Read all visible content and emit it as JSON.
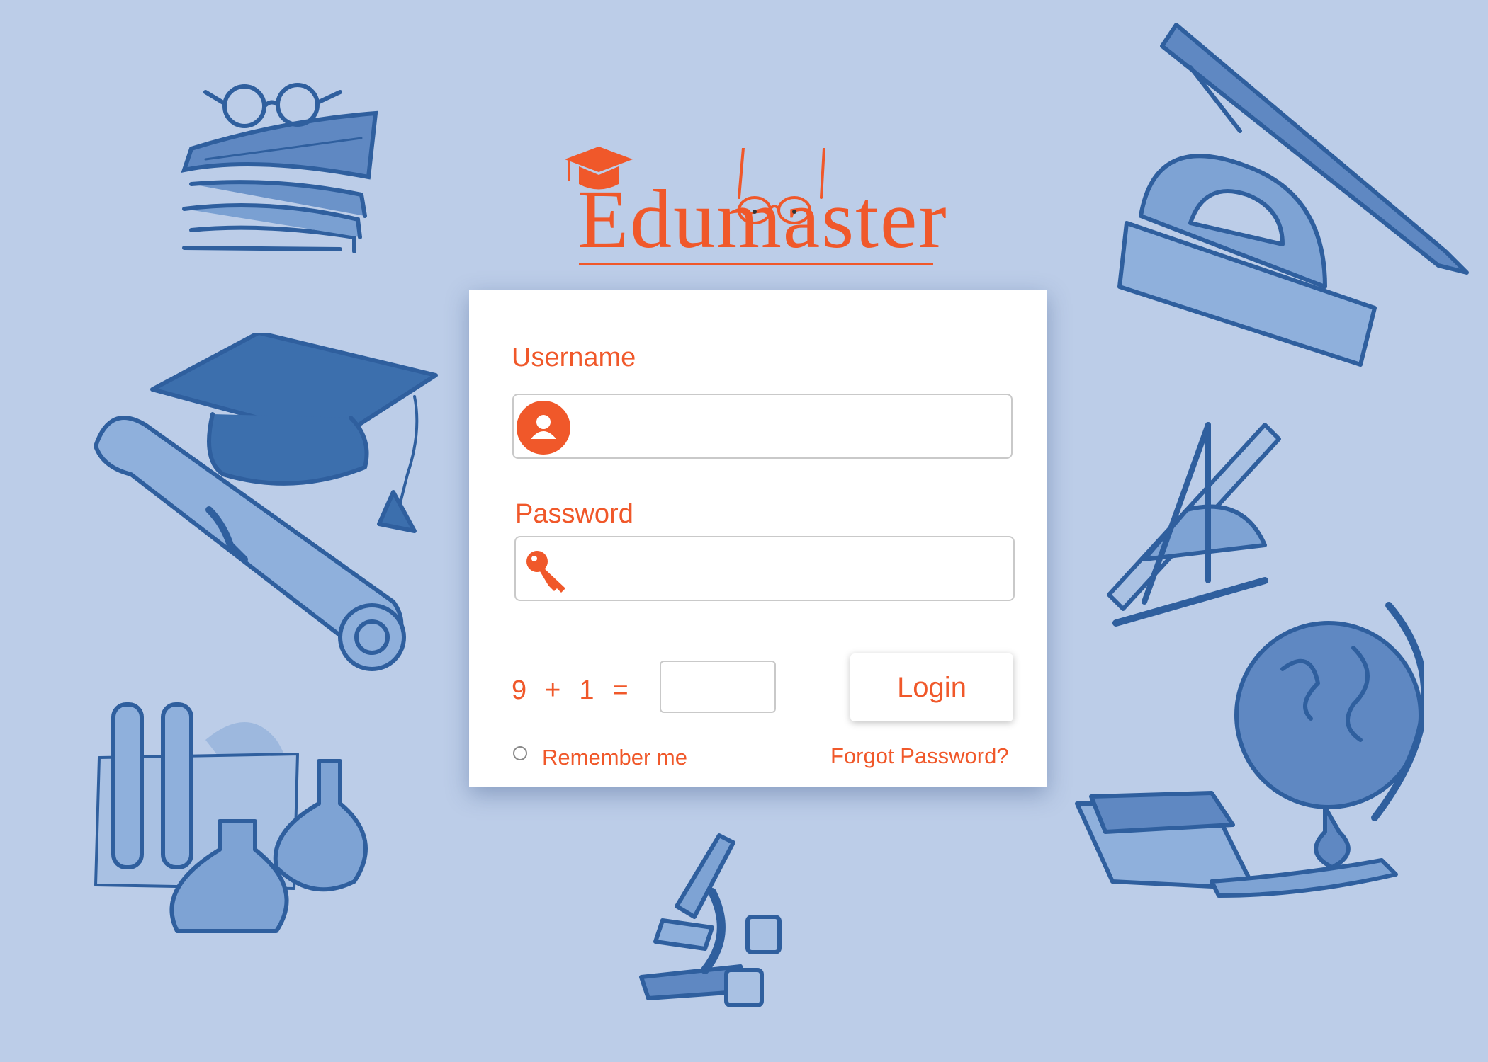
{
  "brand": {
    "logo_text": "Edumaster",
    "accent_color": "#f0582a",
    "background_color": "#bccde8",
    "illustration_color": "#2f5f9e"
  },
  "login_form": {
    "username_label": "Username",
    "username_value": "",
    "username_icon": "user-icon",
    "password_label": "Password",
    "password_value": "",
    "password_icon": "key-icon",
    "captcha": {
      "operand_a": "9",
      "operator": "+",
      "operand_b": "1",
      "equals": "=",
      "answer_value": ""
    },
    "login_button_label": "Login",
    "remember_me_label": "Remember me",
    "remember_me_checked": false,
    "forgot_password_label": "Forgot Password?"
  },
  "decorations": [
    "books-with-glasses-icon",
    "graduation-cap-and-diploma-icon",
    "test-tubes-and-flasks-icon",
    "microscope-icon",
    "pen-and-protractor-icon",
    "compass-and-ruler-icon",
    "globe-and-book-icon"
  ]
}
